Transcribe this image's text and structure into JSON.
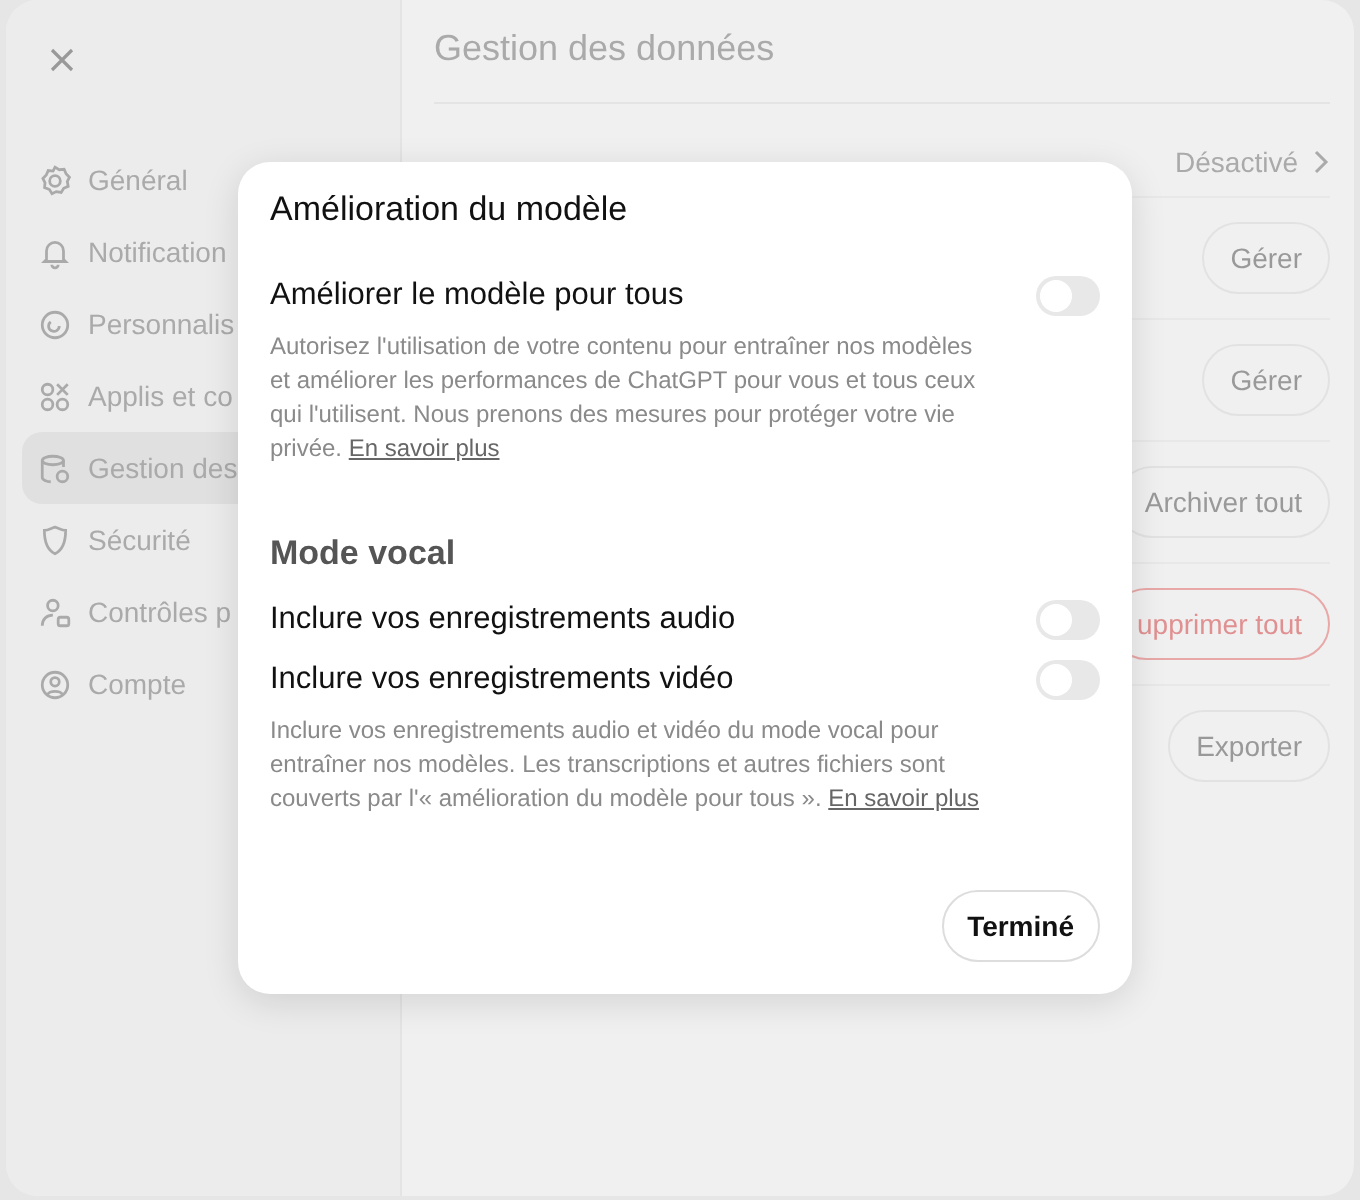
{
  "sidebar": {
    "items": [
      {
        "label": "Général",
        "selected": false
      },
      {
        "label": "Notification",
        "selected": false
      },
      {
        "label": "Personnalis",
        "selected": false
      },
      {
        "label": "Applis et co",
        "selected": false
      },
      {
        "label": "Gestion des",
        "selected": true
      },
      {
        "label": "Sécurité",
        "selected": false
      },
      {
        "label": "Contrôles p",
        "selected": false
      },
      {
        "label": "Compte",
        "selected": false
      }
    ]
  },
  "main": {
    "title": "Gestion des données",
    "status": "Désactivé",
    "buttons": [
      {
        "label": "Gérer",
        "kind": "normal"
      },
      {
        "label": "Gérer",
        "kind": "normal"
      },
      {
        "label": "Archiver tout",
        "kind": "normal"
      },
      {
        "label": "upprimer tout",
        "kind": "danger"
      },
      {
        "label": "Exporter",
        "kind": "normal"
      }
    ]
  },
  "dialog": {
    "title": "Amélioration du modèle",
    "sections": [
      {
        "settings": [
          {
            "label": "Améliorer le modèle pour tous",
            "on": false
          }
        ],
        "description": "Autorisez l'utilisation de votre contenu pour entraîner nos modèles et améliorer les performances de ChatGPT pour vous et tous ceux qui l'utilisent. Nous prenons des mesures pour protéger votre vie privée.",
        "link": "En savoir plus"
      },
      {
        "heading": "Mode vocal",
        "settings": [
          {
            "label": "Inclure vos enregistrements audio",
            "on": false
          },
          {
            "label": "Inclure vos enregistrements vidéo",
            "on": false
          }
        ],
        "description": "Inclure vos enregistrements audio et vidéo du mode vocal pour entraîner nos modèles. Les transcriptions et autres fichiers sont couverts par l'« amélioration du modèle pour tous ».",
        "link": "En savoir plus"
      }
    ],
    "done_button": "Terminé"
  }
}
